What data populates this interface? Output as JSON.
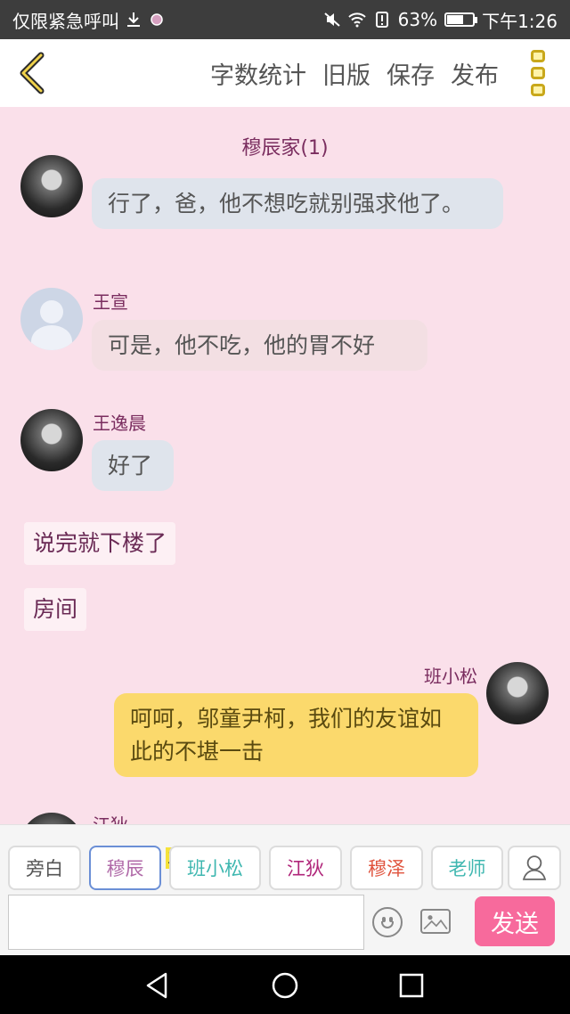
{
  "status_bar": {
    "carrier": "仅限紧急呼叫",
    "battery_percent": "63%",
    "battery_level": 0.63,
    "time": "下午1:26",
    "icons": [
      "download-icon",
      "app-icon",
      "mute-icon",
      "wifi-icon",
      "alert-icon",
      "battery-icon"
    ]
  },
  "header": {
    "actions": [
      "字数统计",
      "旧版",
      "保存",
      "发布"
    ]
  },
  "chat": {
    "room_title": "穆辰家(1)",
    "messages": [
      {
        "type": "left",
        "speaker": "",
        "text": "行了，爸，他不想吃就别强求他了。"
      },
      {
        "type": "left",
        "speaker": "王宣",
        "text": "可是，他不吃，他的胃不好"
      },
      {
        "type": "left",
        "speaker": "王逸晨",
        "text": "好了"
      },
      {
        "type": "narration",
        "text": "说完就下楼了"
      },
      {
        "type": "narration",
        "text": "房间"
      },
      {
        "type": "right",
        "speaker": "班小松",
        "text": "呵呵，邬童尹柯，我们的友谊如此的不堪一击"
      },
      {
        "type": "left",
        "speaker": "江狄",
        "text": ""
      }
    ]
  },
  "roles": {
    "items": [
      {
        "label": "旁白",
        "color": "#555555"
      },
      {
        "label": "穆辰",
        "color": "#b06aa8"
      },
      {
        "label": "班小松",
        "color": "#3fb7b0"
      },
      {
        "label": "江狄",
        "color": "#b0267a"
      },
      {
        "label": "穆泽",
        "color": "#e0533d"
      },
      {
        "label": "老师",
        "color": "#3fb7b0"
      }
    ],
    "selected": "穆辰",
    "host_tag": "主"
  },
  "composer": {
    "input_value": "",
    "send_label": "发送"
  }
}
